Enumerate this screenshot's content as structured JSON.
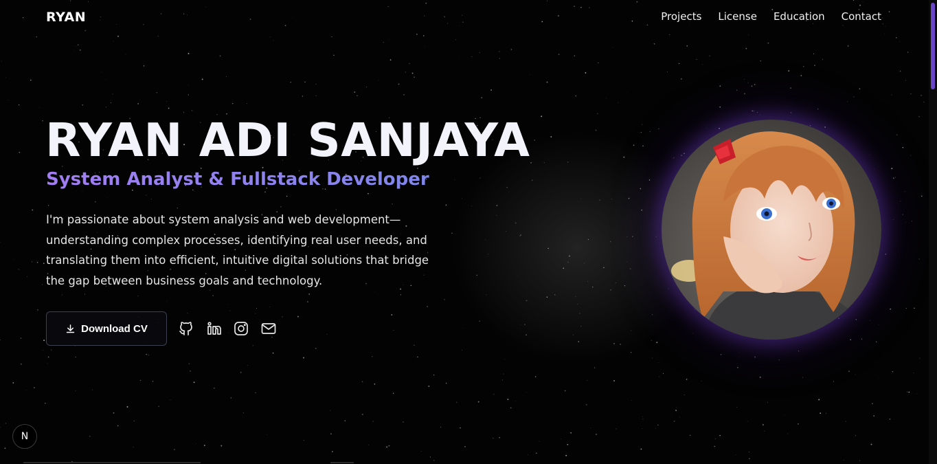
{
  "nav": {
    "logo": "RYAN",
    "links": [
      "Projects",
      "License",
      "Education",
      "Contact"
    ]
  },
  "hero": {
    "name": "RYAN ADI SANJAYA",
    "subtitle": "System Analyst & Fullstack Developer",
    "description": "I'm passionate about system analysis and web development—understanding complex processes, identifying real user needs, and translating them into efficient, intuitive digital solutions that bridge the gap between business goals and technology.",
    "cta_label": "Download CV",
    "socials": [
      "github-icon",
      "linkedin-icon",
      "instagram-icon",
      "mail-icon"
    ]
  },
  "badge": {
    "label": "N"
  },
  "colors": {
    "background": "#030303",
    "accent": "#9a7cf0",
    "button_border": "#3d4050",
    "scroll_thumb": "#6b46c8"
  }
}
